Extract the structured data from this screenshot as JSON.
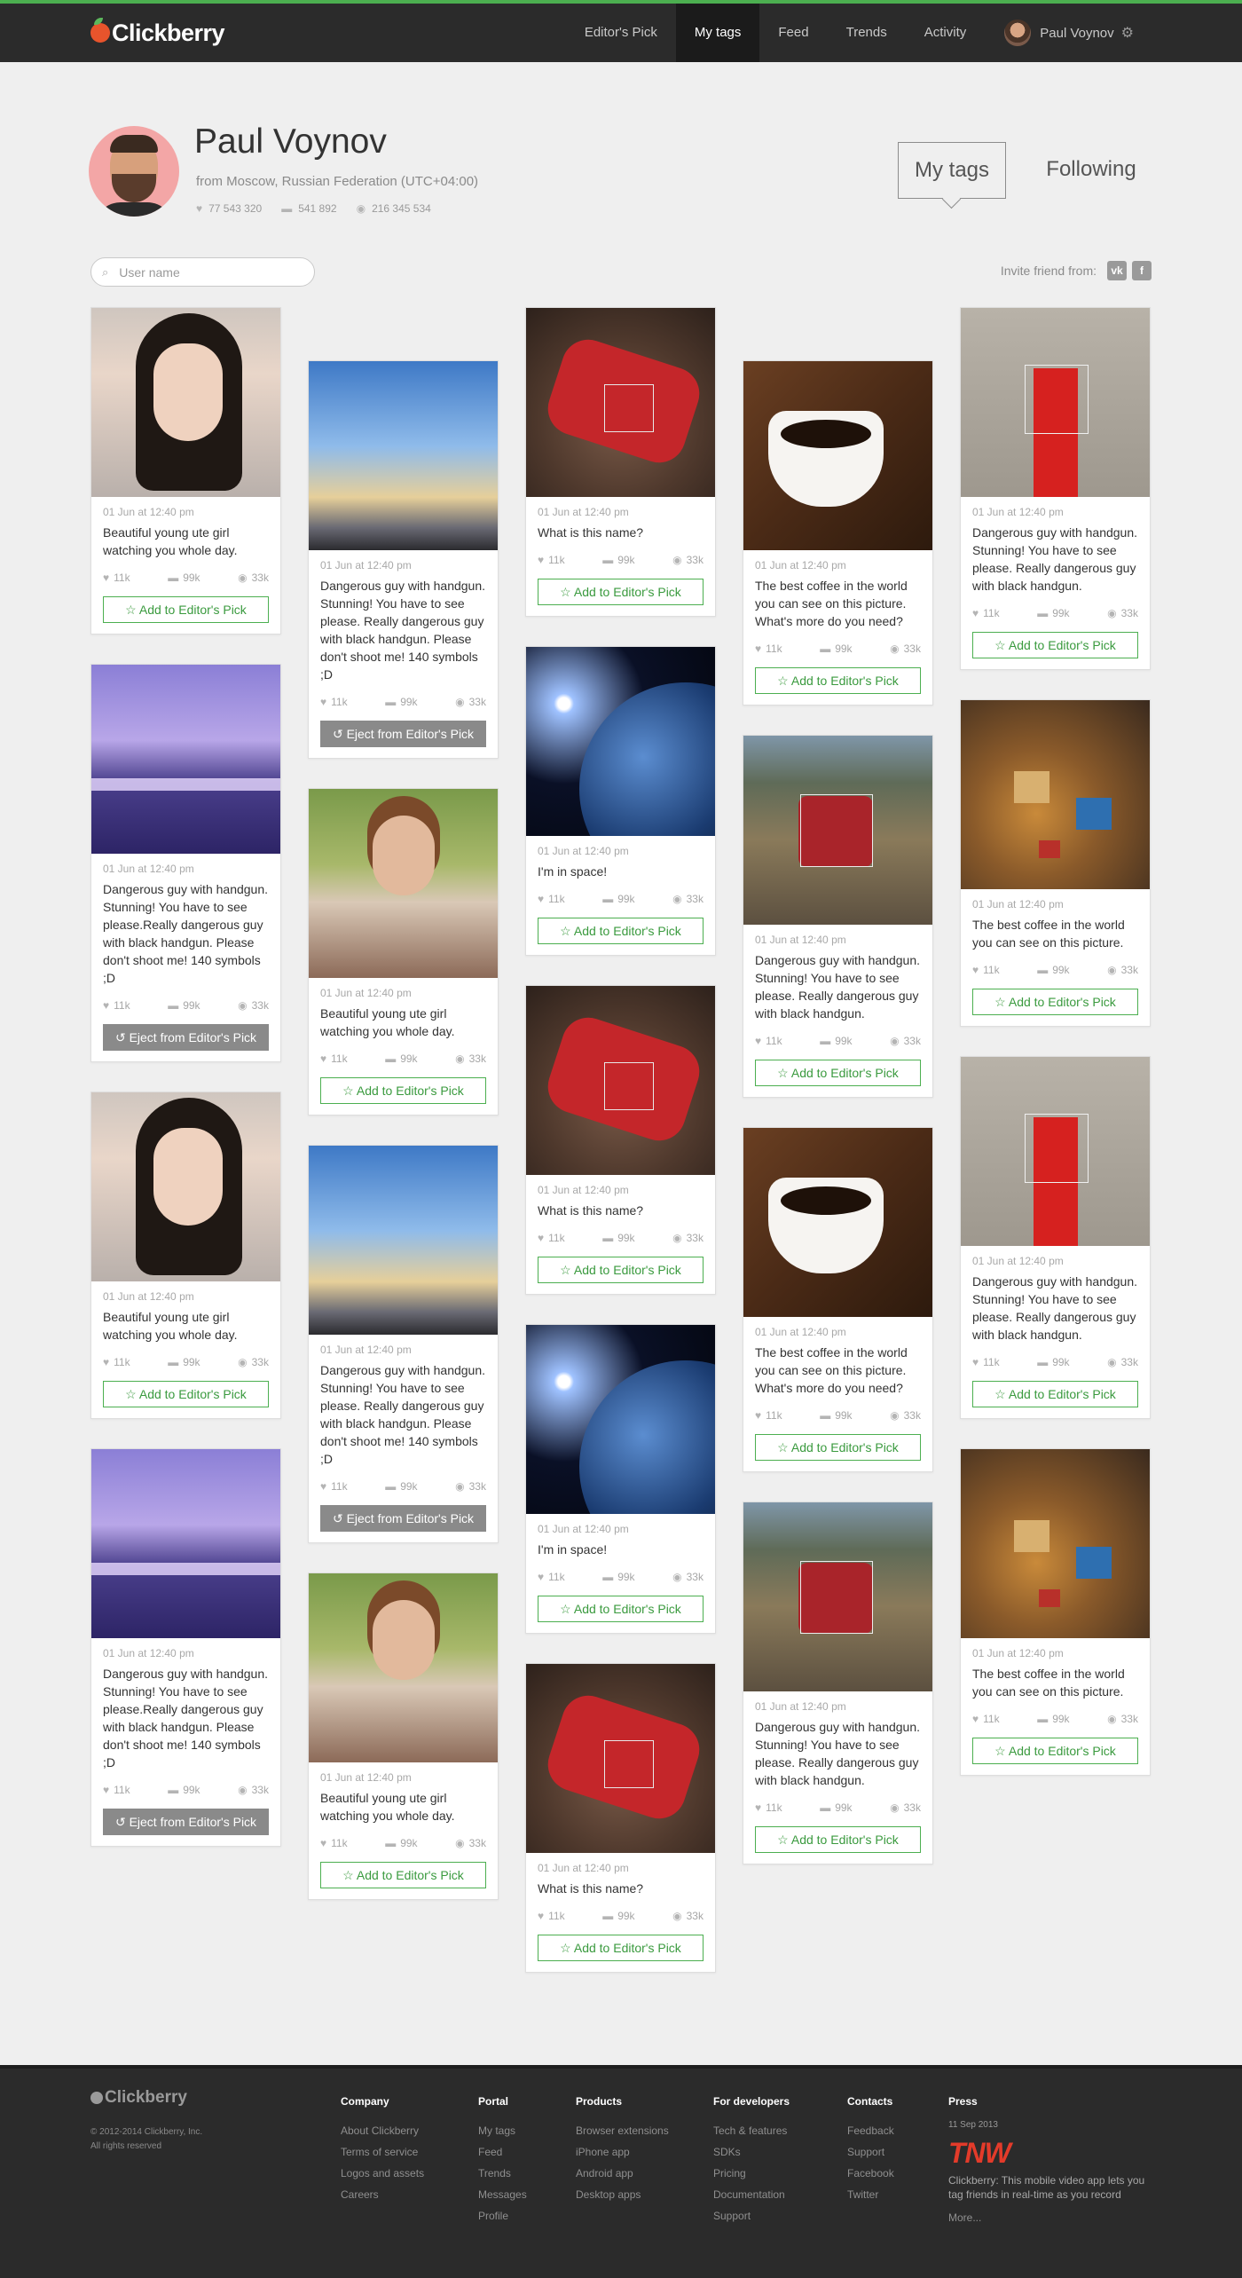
{
  "header": {
    "logo": "Clickberry",
    "nav": [
      "Editor's Pick",
      "My tags",
      "Feed",
      "Trends",
      "Activity"
    ],
    "active_nav": "My tags",
    "user_name": "Paul Voynov"
  },
  "profile": {
    "name": "Paul Voynov",
    "location": "from Moscow, Russian Federation (UTC+04:00)",
    "stats": {
      "likes": "77 543 320",
      "comments": "541 892",
      "views": "216 345 534"
    },
    "tabs": [
      "My tags",
      "Following"
    ]
  },
  "search": {
    "placeholder": "User name"
  },
  "invite": {
    "label": "Invite friend from:",
    "networks": [
      "vk",
      "f"
    ]
  },
  "icons": {
    "heart": "♥",
    "comment": "▬",
    "eye": "◉",
    "star": "☆",
    "undo": "↺",
    "gear": "⚙",
    "search": "⌕"
  },
  "cards": [
    {
      "img": "girl",
      "date": "01 Jun at 12:40 pm",
      "text": "Beautiful young ute girl watching you whole day.",
      "likes": "11k",
      "comments": "99k",
      "views": "33k",
      "button": "Add to Editor's Pick",
      "btn_type": "add"
    },
    {
      "img": "london",
      "date": "01 Jun at 12:40 pm",
      "text": "Dangerous guy with handgun. Stunning! You have to see please.Really dangerous guy with black handgun. Please don't shoot me! 140 symbols ;D",
      "likes": "11k",
      "comments": "99k",
      "views": "33k",
      "button": "Eject from Editor's Pick",
      "btn_type": "eject"
    },
    {
      "img": "girl",
      "date": "01 Jun at 12:40 pm",
      "text": "Beautiful young ute girl watching you whole day.",
      "likes": "11k",
      "comments": "99k",
      "views": "33k",
      "button": "Add to Editor's Pick",
      "btn_type": "add"
    },
    {
      "img": "london",
      "date": "01 Jun at 12:40 pm",
      "text": "Dangerous guy with handgun. Stunning! You have to see please.Really dangerous guy with black handgun. Please don't shoot me! 140 symbols ;D",
      "likes": "11k",
      "comments": "99k",
      "views": "33k",
      "button": "Eject from Editor's Pick",
      "btn_type": "eject"
    },
    {
      "img": "sky",
      "date": "01 Jun at 12:40 pm",
      "text": "Dangerous guy with handgun. Stunning! You have to see please.\nReally dangerous guy with black handgun. Please don't shoot me! 140 symbols ;D",
      "likes": "11k",
      "comments": "99k",
      "views": "33k",
      "button": "Eject from Editor's Pick",
      "btn_type": "eject"
    },
    {
      "img": "woman",
      "date": "01 Jun at 12:40 pm",
      "text": "Beautiful young ute girl watching you whole day.",
      "likes": "11k",
      "comments": "99k",
      "views": "33k",
      "button": "Add to Editor's Pick",
      "btn_type": "add"
    },
    {
      "img": "sky",
      "date": "01 Jun at 12:40 pm",
      "text": "Dangerous guy with handgun. Stunning! You have to see please.\nReally dangerous guy with black handgun. Please don't shoot me! 140 symbols ;D",
      "likes": "11k",
      "comments": "99k",
      "views": "33k",
      "button": "Eject from Editor's Pick",
      "btn_type": "eject"
    },
    {
      "img": "woman",
      "date": "01 Jun at 12:40 pm",
      "text": "Beautiful young ute girl watching you whole day.",
      "likes": "11k",
      "comments": "99k",
      "views": "33k",
      "button": "Add to Editor's Pick",
      "btn_type": "add"
    },
    {
      "img": "moto",
      "date": "01 Jun at 12:40 pm",
      "text": "What is this name?",
      "likes": "11k",
      "comments": "99k",
      "views": "33k",
      "button": "Add to Editor's Pick",
      "btn_type": "add"
    },
    {
      "img": "earth",
      "date": "01 Jun at 12:40 pm",
      "text": "I'm in space!",
      "likes": "11k",
      "comments": "99k",
      "views": "33k",
      "button": "Add to Editor's Pick",
      "btn_type": "add"
    },
    {
      "img": "moto",
      "date": "01 Jun at 12:40 pm",
      "text": "What is this name?",
      "likes": "11k",
      "comments": "99k",
      "views": "33k",
      "button": "Add to Editor's Pick",
      "btn_type": "add"
    },
    {
      "img": "earth",
      "date": "01 Jun at 12:40 pm",
      "text": "I'm in space!",
      "likes": "11k",
      "comments": "99k",
      "views": "33k",
      "button": "Add to Editor's Pick",
      "btn_type": "add"
    },
    {
      "img": "moto",
      "date": "01 Jun at 12:40 pm",
      "text": "What is this name?",
      "likes": "11k",
      "comments": "99k",
      "views": "33k",
      "button": "Add to Editor's Pick",
      "btn_type": "add"
    },
    {
      "img": "coffee",
      "date": "01 Jun at 12:40 pm",
      "text": "The best coffee in the world you can see on this picture. What's more do you need?",
      "likes": "11k",
      "comments": "99k",
      "views": "33k",
      "button": "Add to Editor's Pick",
      "btn_type": "add"
    },
    {
      "img": "car",
      "date": "01 Jun at 12:40 pm",
      "text": "Dangerous guy with handgun. Stunning! You have to see please. Really dangerous guy with black handgun.",
      "likes": "11k",
      "comments": "99k",
      "views": "33k",
      "button": "Add to Editor's Pick",
      "btn_type": "add"
    },
    {
      "img": "coffee",
      "date": "01 Jun at 12:40 pm",
      "text": "The best coffee in the world you can see on this picture. What's more do you need?",
      "likes": "11k",
      "comments": "99k",
      "views": "33k",
      "button": "Add to Editor's Pick",
      "btn_type": "add"
    },
    {
      "img": "car",
      "date": "01 Jun at 12:40 pm",
      "text": "Dangerous guy with handgun. Stunning! You have to see please. Really dangerous guy with black handgun.",
      "likes": "11k",
      "comments": "99k",
      "views": "33k",
      "button": "Add to Editor's Pick",
      "btn_type": "add"
    },
    {
      "img": "booth",
      "date": "01 Jun at 12:40 pm",
      "text": "Dangerous guy with handgun. Stunning! You have to see please. Really dangerous guy with black handgun.",
      "likes": "11k",
      "comments": "99k",
      "views": "33k",
      "button": "Add to Editor's Pick",
      "btn_type": "add"
    },
    {
      "img": "board",
      "date": "01 Jun at 12:40 pm",
      "text": "The best coffee in the world you can see on this picture.",
      "likes": "11k",
      "comments": "99k",
      "views": "33k",
      "button": "Add to Editor's Pick",
      "btn_type": "add"
    },
    {
      "img": "booth",
      "date": "01 Jun at 12:40 pm",
      "text": "Dangerous guy with handgun. Stunning! You have to see please. Really dangerous guy with black handgun.",
      "likes": "11k",
      "comments": "99k",
      "views": "33k",
      "button": "Add to Editor's Pick",
      "btn_type": "add"
    },
    {
      "img": "board",
      "date": "01 Jun at 12:40 pm",
      "text": "The best coffee in the world you can see on this picture.",
      "likes": "11k",
      "comments": "99k",
      "views": "33k",
      "button": "Add to Editor's Pick",
      "btn_type": "add"
    }
  ],
  "footer": {
    "logo": "Clickberry",
    "copyright": "© 2012-2014 Clickberry, Inc.",
    "rights": "All rights reserved",
    "columns": [
      {
        "title": "Company",
        "links": [
          "About Clickberry",
          "Terms of service",
          "Logos and assets",
          "Careers"
        ]
      },
      {
        "title": "Portal",
        "links": [
          "My tags",
          "Feed",
          "Trends",
          "Messages",
          "Profile"
        ]
      },
      {
        "title": "Products",
        "links": [
          "Browser extensions",
          "iPhone app",
          "Android app",
          "Desktop apps"
        ]
      },
      {
        "title": "For developers",
        "links": [
          "Tech & features",
          "SDKs",
          "Pricing",
          "Documentation",
          "Support"
        ]
      },
      {
        "title": "Contacts",
        "links": [
          "Feedback",
          "Support",
          "Facebook",
          "Twitter"
        ]
      }
    ],
    "press": {
      "title": "Press",
      "date": "11 Sep 2013",
      "source": "TNW",
      "text": "Clickberry: This mobile video app lets you tag friends in real-time as you record",
      "more": "More..."
    }
  },
  "colors": {
    "accent": "#4caf50",
    "topbar": "#2b2b2b",
    "eject": "#8a8a8a",
    "background": "#efefef"
  }
}
